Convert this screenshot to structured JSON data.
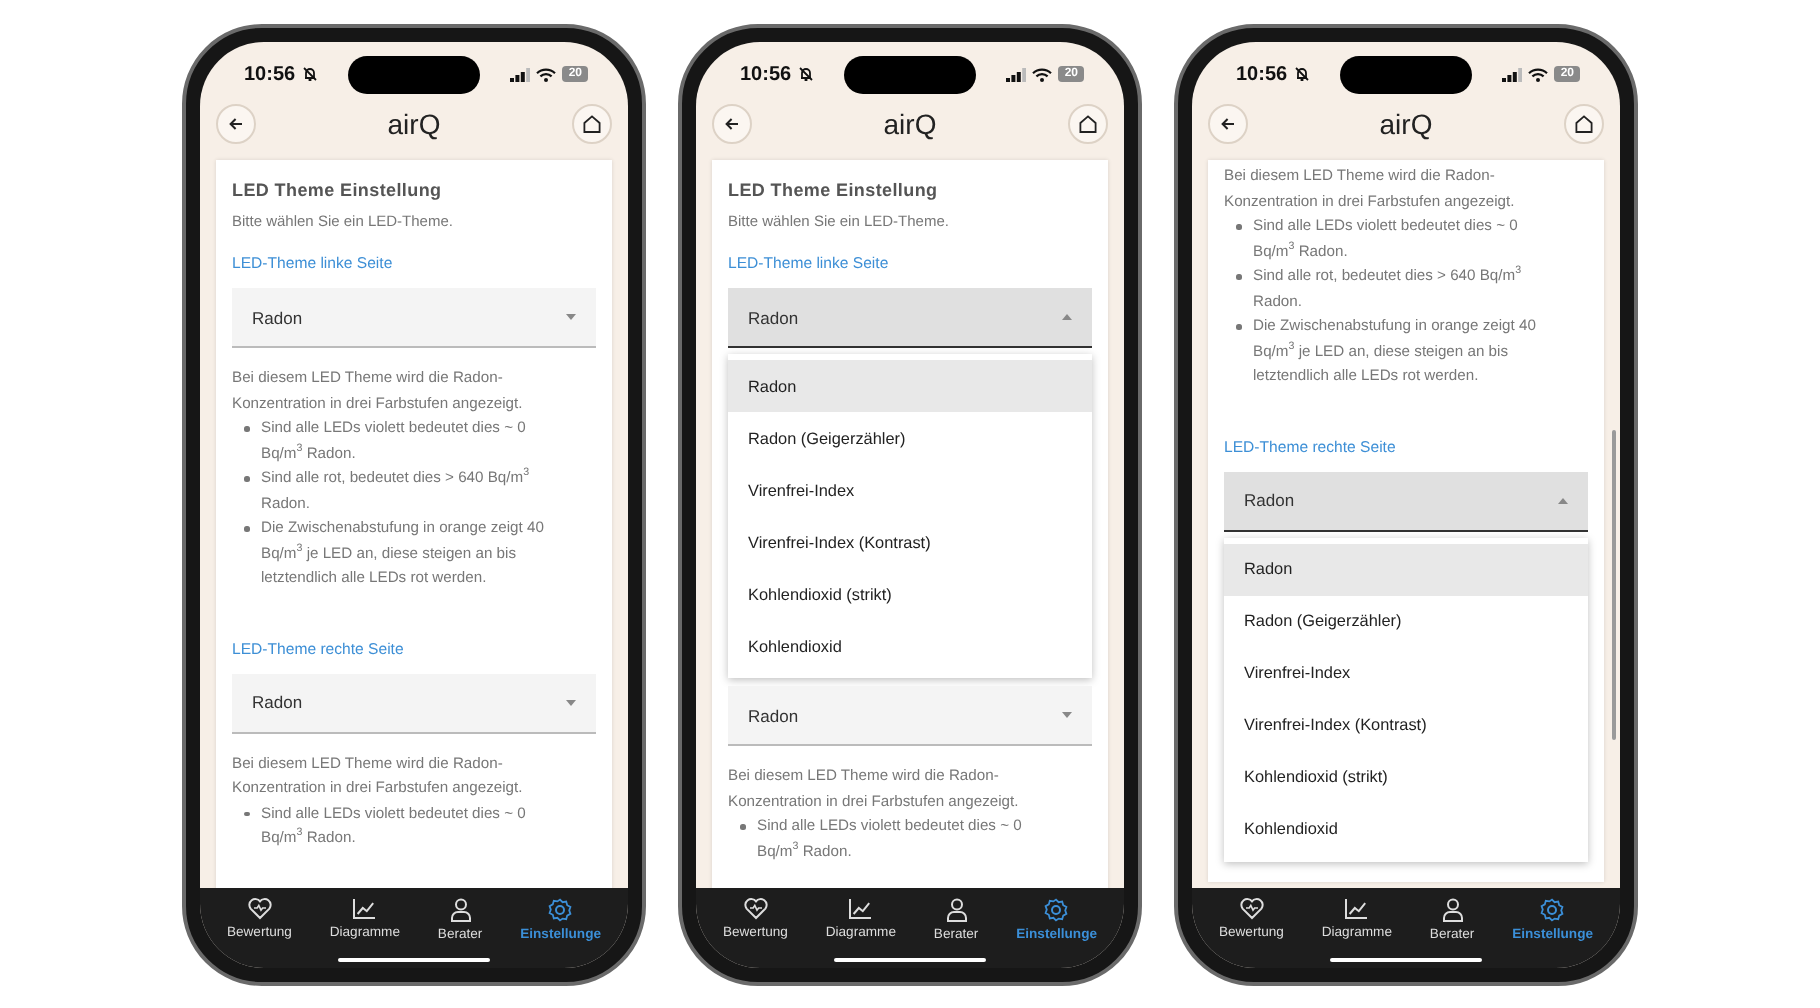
{
  "phones": [
    {
      "status": {
        "time": "10:56",
        "battery": "20"
      },
      "header": {
        "title": "airQ"
      },
      "blocks": [
        {
          "kind": "heading",
          "text": "LED Theme Einstellung"
        },
        {
          "kind": "hint",
          "text": "Bitte wählen Sie ein LED-Theme."
        },
        {
          "kind": "label",
          "text": "LED-Theme linke Seite"
        },
        {
          "kind": "select",
          "value": "Radon",
          "open": false
        },
        {
          "kind": "description",
          "intro": "Bei diesem LED Theme wird die Radon-Konzentration in drei Farbstufen angezeigt.",
          "bullets": [
            "Sind alle LEDs violett bedeutet dies ~ 0 Bq/m$^{3}$ Radon.",
            "Sind alle rot, bedeutet dies > 640 Bq/m$^{3}$ Radon.",
            "Die Zwischenabstufung in orange zeigt 40 Bq/m$^{3}$ je LED an, diese steigen an bis letztendlich alle LEDs rot werden."
          ]
        },
        {
          "kind": "label",
          "text": "LED-Theme rechte Seite"
        },
        {
          "kind": "select",
          "value": "Radon",
          "open": false
        },
        {
          "kind": "description",
          "intro": "Bei diesem LED Theme wird die Radon-Konzentration in drei Farbstufen angezeigt.",
          "bullets": [
            "Sind alle LEDs violett bedeutet dies ~ 0 Bq/m$^{3}$ Radon."
          ]
        }
      ],
      "nav": [
        {
          "label": "Bewertung",
          "selected": false
        },
        {
          "label": "Diagramme",
          "selected": false
        },
        {
          "label": "Berater",
          "selected": false
        },
        {
          "label": "Einstellunge",
          "selected": true
        }
      ]
    },
    {
      "status": {
        "time": "10:56",
        "battery": "20"
      },
      "header": {
        "title": "airQ"
      },
      "blocks": [
        {
          "kind": "heading",
          "text": "LED Theme Einstellung"
        },
        {
          "kind": "hint",
          "text": "Bitte wählen Sie ein LED-Theme."
        },
        {
          "kind": "label",
          "text": "LED-Theme linke Seite"
        },
        {
          "kind": "select",
          "value": "Radon",
          "open": true
        },
        {
          "kind": "menu",
          "options": [
            {
              "label": "Radon",
              "selected": true
            },
            {
              "label": "Radon (Geigerzähler)",
              "selected": false
            },
            {
              "label": "Virenfrei-Index",
              "selected": false
            },
            {
              "label": "Virenfrei-Index (Kontrast)",
              "selected": false
            },
            {
              "label": "Kohlendioxid (strikt)",
              "selected": false
            },
            {
              "label": "Kohlendioxid",
              "selected": false
            }
          ]
        },
        {
          "kind": "select",
          "value": "Radon",
          "open": false
        },
        {
          "kind": "description",
          "intro": "Bei diesem LED Theme wird die Radon-Konzentration in drei Farbstufen angezeigt.",
          "bullets": [
            "Sind alle LEDs violett bedeutet dies ~ 0 Bq/m$^{3}$ Radon."
          ]
        }
      ],
      "nav": [
        {
          "label": "Bewertung",
          "selected": false
        },
        {
          "label": "Diagramme",
          "selected": false
        },
        {
          "label": "Berater",
          "selected": false
        },
        {
          "label": "Einstellunge",
          "selected": true
        }
      ]
    },
    {
      "status": {
        "time": "10:56",
        "battery": "20"
      },
      "header": {
        "title": "airQ"
      },
      "blocks": [
        {
          "kind": "description",
          "intro": "Bei diesem LED Theme wird die Radon-Konzentration in drei Farbstufen angezeigt.",
          "bullets": [
            "Sind alle LEDs violett bedeutet dies ~ 0 Bq/m$^{3}$ Radon.",
            "Sind alle rot, bedeutet dies > 640 Bq/m$^{3}$ Radon.",
            "Die Zwischenabstufung in orange zeigt 40 Bq/m$^{3}$ je LED an, diese steigen an bis letztendlich alle LEDs rot werden."
          ]
        },
        {
          "kind": "label",
          "text": "LED-Theme rechte Seite"
        },
        {
          "kind": "select",
          "value": "Radon",
          "open": true
        },
        {
          "kind": "menu",
          "options": [
            {
              "label": "Radon",
              "selected": true
            },
            {
              "label": "Radon (Geigerzähler)",
              "selected": false
            },
            {
              "label": "Virenfrei-Index",
              "selected": false
            },
            {
              "label": "Virenfrei-Index (Kontrast)",
              "selected": false
            },
            {
              "label": "Kohlendioxid (strikt)",
              "selected": false
            },
            {
              "label": "Kohlendioxid",
              "selected": false
            }
          ]
        }
      ],
      "nav": [
        {
          "label": "Bewertung",
          "selected": false
        },
        {
          "label": "Diagramme",
          "selected": false
        },
        {
          "label": "Berater",
          "selected": false
        },
        {
          "label": "Einstellunge",
          "selected": true
        }
      ]
    }
  ]
}
